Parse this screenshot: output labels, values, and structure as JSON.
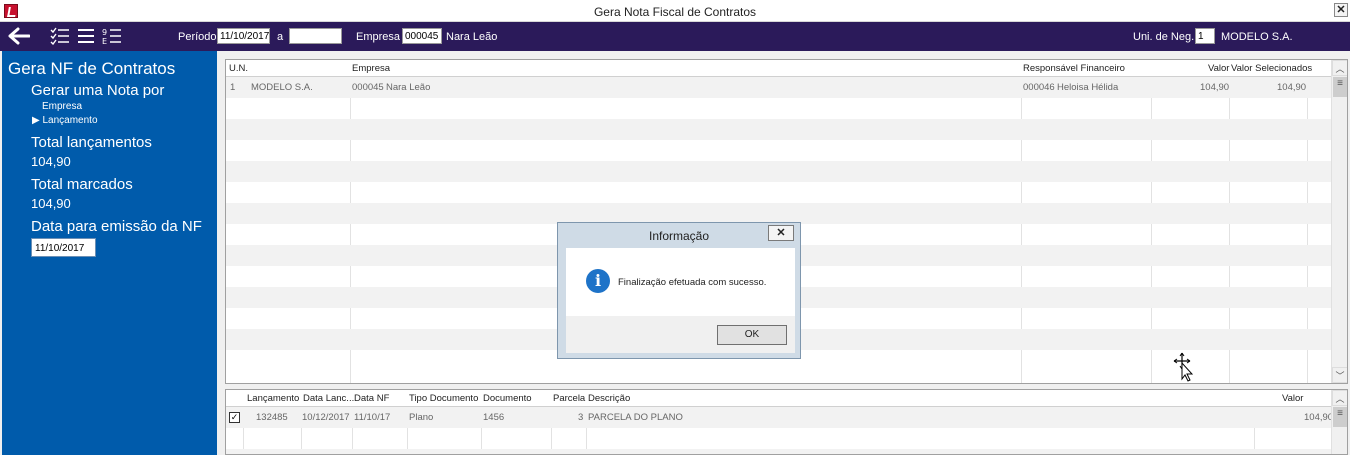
{
  "window": {
    "title": "Gera Nota Fiscal de Contratos",
    "close_glyph": "✕"
  },
  "toolbar": {
    "back_icon": "arrow-left-icon",
    "periodo_label": "Período",
    "periodo_start": "11/10/2017",
    "periodo_sep": "a",
    "periodo_end": "",
    "empresa_label": "Empresa",
    "empresa_code": "000045",
    "empresa_name": "Nara Leão",
    "unineg_label": "Uni. de Neg.",
    "unineg_code": "1",
    "unineg_name": "MODELO S.A."
  },
  "sidebar": {
    "title": "Gera NF de Contratos",
    "gerar_label": "Gerar uma Nota por",
    "option_empresa": "Empresa",
    "option_lancamento": "▶ Lançamento",
    "total_lanc_label": "Total lançamentos",
    "total_lanc_value": "104,90",
    "total_marc_label": "Total marcados",
    "total_marc_value": "104,90",
    "data_label": "Data para emissão da NF",
    "data_value": "11/10/2017"
  },
  "upper_grid": {
    "columns": [
      "U.N.",
      "Empresa",
      "Responsável Financeiro",
      "Valor",
      "Valor Selecionados"
    ],
    "rows": [
      {
        "un": "1",
        "un_name": "MODELO S.A.",
        "emp_code": "000045",
        "emp_name": "Nara Leão",
        "resp_code": "000046",
        "resp_name": "Heloisa Hélida",
        "valor": "104,90",
        "valor_sel": "104,90"
      }
    ]
  },
  "lower_grid": {
    "columns": [
      "Lançamento",
      "Data Lanc...",
      "Data NF",
      "Tipo Documento",
      "Documento",
      "Parcela",
      "Descrição",
      "Valor"
    ],
    "rows": [
      {
        "checked": "✓",
        "lancamento": "132485",
        "data_lanc": "10/12/2017",
        "data_nf": "11/10/17",
        "tipo_doc": "Plano",
        "documento": "1456",
        "parcela": "3",
        "descricao": "PARCELA DO PLANO",
        "valor": "104,90"
      }
    ]
  },
  "dialog": {
    "title": "Informação",
    "close_glyph": "✕",
    "icon": "info-icon",
    "message": "Finalização efetuada com sucesso.",
    "ok_label": "OK"
  }
}
